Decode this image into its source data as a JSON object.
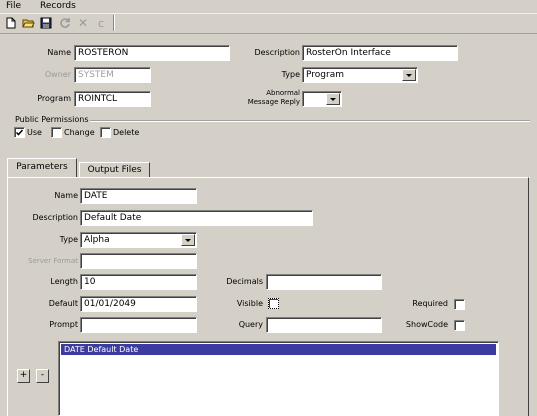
{
  "menu": {
    "file": "File",
    "records": "Records"
  },
  "toolbar": {
    "new_icon": "new-document-icon",
    "open_icon": "open-folder-icon",
    "save_icon": "floppy-disk-icon",
    "refresh_icon": "refresh-icon",
    "delete_icon": "x-delete-icon",
    "cancel_icon": "c-cancel-icon"
  },
  "form": {
    "name_label": "Name",
    "name_value": "ROSTERON",
    "owner_label": "Owner",
    "owner_value": "SYSTEM",
    "program_label": "Program",
    "program_value": "ROINTCL",
    "description_label": "Description",
    "description_value": "RosterOn Interface",
    "type_label": "Type",
    "type_value": "Program",
    "abnormal_label_1": "Abnormal",
    "abnormal_label_2": "Message Reply",
    "abnormal_value": ""
  },
  "permissions": {
    "title": "Public Permissions",
    "use_label": "Use",
    "use_checked": true,
    "change_label": "Change",
    "change_checked": false,
    "delete_label": "Delete",
    "delete_checked": false
  },
  "tabs": [
    {
      "label": "Parameters",
      "active": true
    },
    {
      "label": "Output Files",
      "active": false
    }
  ],
  "params": {
    "name_label": "Name",
    "name_value": "DATE",
    "description_label": "Description",
    "description_value": "Default Date",
    "type_label": "Type",
    "type_value": "Alpha",
    "server_format_label": "Server Format",
    "server_format_value": "",
    "length_label": "Length",
    "length_value": "10",
    "decimals_label": "Decimals",
    "decimals_value": "",
    "default_label": "Default",
    "default_value": "01/01/2049",
    "visible_label": "Visible",
    "visible_checked": false,
    "required_label": "Required",
    "required_checked": false,
    "prompt_label": "Prompt",
    "prompt_value": "",
    "query_label": "Query",
    "query_value": "",
    "showcode_label": "ShowCode",
    "showcode_checked": false,
    "add_label": "+",
    "remove_label": "-",
    "list_items": [
      {
        "text": "DATE Default Date",
        "selected": true
      }
    ]
  },
  "colors": {
    "background": "#d4d0c8",
    "selection": "#3c3ca0",
    "field": "#ffffff"
  }
}
